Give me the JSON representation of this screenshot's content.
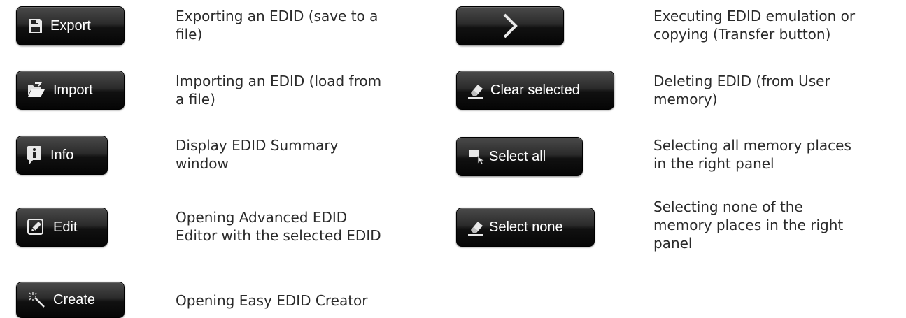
{
  "rows": [
    {
      "button": "Export",
      "icon": "save-icon",
      "desc": "Exporting an EDID (save to a\nfile)"
    },
    {
      "button": "Import",
      "icon": "folder-open-icon",
      "desc": "Importing an EDID (load from\na file)"
    },
    {
      "button": "Info",
      "icon": "info-icon",
      "desc": "Display EDID  Summary\nwindow"
    },
    {
      "button": "Edit",
      "icon": "pencil-icon",
      "desc": "Opening Advanced EDID\nEditor with the selected EDID"
    },
    {
      "button": "Create",
      "icon": "magic-wand-icon",
      "desc": "Opening Easy EDID Creator"
    },
    {
      "button": "",
      "icon": "chevron-right-icon",
      "desc": "Executing EDID emulation or\ncopying (Transfer button)"
    },
    {
      "button": "Clear selected",
      "icon": "eraser-icon",
      "desc": "Deleting EDID (from User\nmemory)"
    },
    {
      "button": "Select all",
      "icon": "select-cursor-icon",
      "desc": "Selecting all memory places\nin the right panel"
    },
    {
      "button": "Select none",
      "icon": "eraser-icon",
      "desc": "Selecting none of the\nmemory places in the right\npanel"
    }
  ]
}
